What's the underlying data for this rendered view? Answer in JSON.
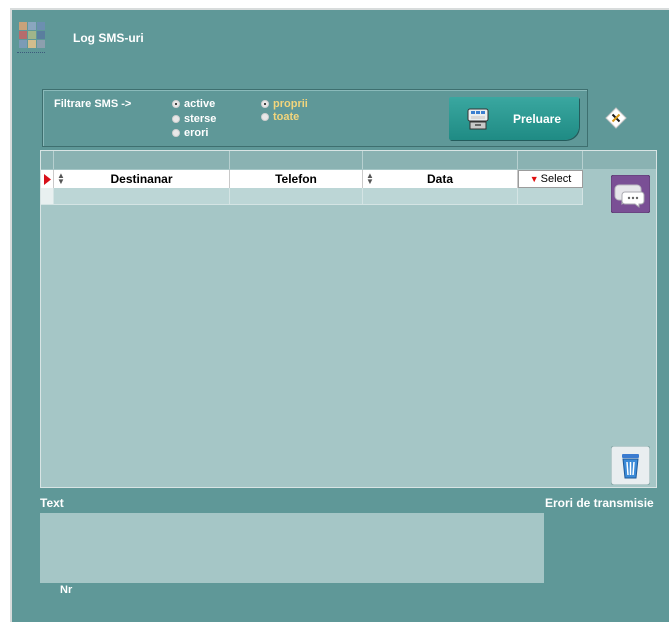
{
  "window": {
    "title": "Log SMS-uri"
  },
  "filter": {
    "label": "Filtrare SMS ->",
    "status_options": [
      {
        "label": "active",
        "selected": true
      },
      {
        "label": "sterse",
        "selected": false
      },
      {
        "label": "erori",
        "selected": false
      }
    ],
    "scope_options": [
      {
        "label": "proprii",
        "selected": true
      },
      {
        "label": "toate",
        "selected": false
      }
    ]
  },
  "toolbar": {
    "preluare_label": "Preluare"
  },
  "grid": {
    "columns": [
      "Destinanar",
      "Telefon",
      "Data"
    ],
    "select_label": "Select"
  },
  "bottom": {
    "text_label": "Text",
    "errors_label": "Erori de transmisie",
    "nr_label": "Nr"
  },
  "colors": {
    "background": "#5f9898",
    "grid_bg": "#a5c6c6",
    "accent_yellow": "#f2d57c",
    "button_teal": "#2a9a93",
    "chat_purple": "#7a4f95"
  },
  "icons": [
    "app-logo-icon",
    "cash-register-icon",
    "close-diamond-icon",
    "chat-bubble-icon",
    "trash-can-icon",
    "row-pointer-icon"
  ]
}
